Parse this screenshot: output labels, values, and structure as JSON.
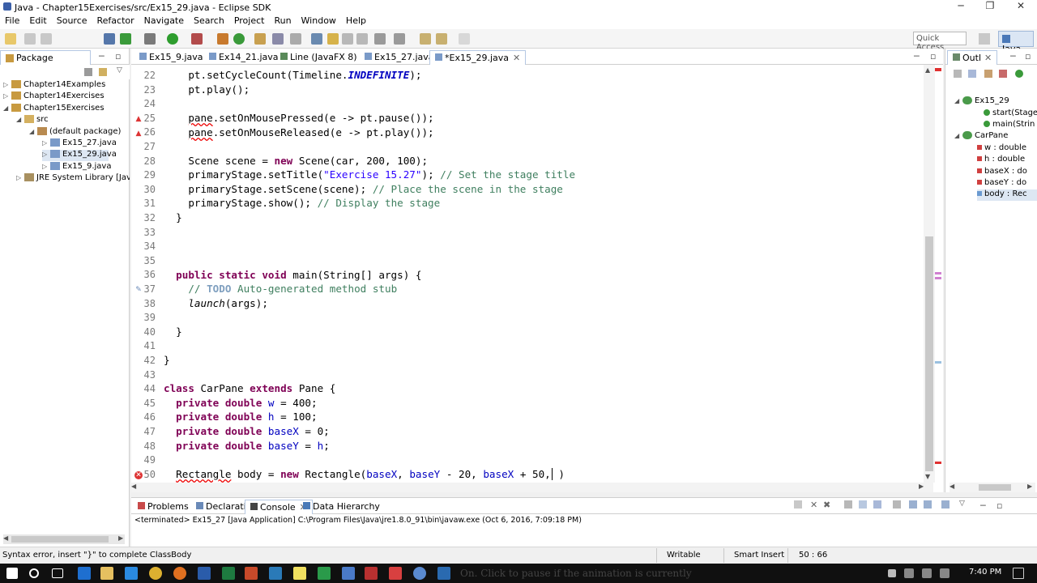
{
  "window": {
    "title": "Java - Chapter15Exercises/src/Ex15_29.java - Eclipse SDK",
    "minimize": "─",
    "maximize": "❐",
    "close": "✕"
  },
  "menu": [
    "File",
    "Edit",
    "Source",
    "Refactor",
    "Navigate",
    "Search",
    "Project",
    "Run",
    "Window",
    "Help"
  ],
  "toolbar": {
    "quick_access_placeholder": "Quick Access",
    "perspective_label": "Java"
  },
  "package_explorer": {
    "title": "Package Explorer",
    "items": [
      {
        "label": "Chapter14Examples"
      },
      {
        "label": "Chapter14Exercises"
      },
      {
        "label": "Chapter15Exercises"
      },
      {
        "label": "src"
      },
      {
        "label": "(default package)"
      },
      {
        "label": "Ex15_27.java"
      },
      {
        "label": "Ex15_29.java"
      },
      {
        "label": "Ex15_9.java"
      },
      {
        "label": "JRE System Library [JavaS"
      }
    ]
  },
  "editor": {
    "tabs": [
      {
        "label": "Ex15_9.java"
      },
      {
        "label": "Ex14_21.java"
      },
      {
        "label": "Line (JavaFX 8)"
      },
      {
        "label": "Ex15_27.java"
      },
      {
        "label": "*Ex15_29.java"
      }
    ],
    "line_numbers": [
      "22",
      "23",
      "24",
      "25",
      "26",
      "27",
      "28",
      "29",
      "30",
      "31",
      "32",
      "33",
      "34",
      "35",
      "36",
      "37",
      "38",
      "39",
      "40",
      "41",
      "42",
      "43",
      "44",
      "45",
      "46",
      "47",
      "48",
      "49",
      "50"
    ],
    "code": {
      "l22a": "pt.setCycleCount(Timeline.",
      "l22b": "INDEFINITE",
      "l22c": ");",
      "l23": "pt.play();",
      "l25a": "pane",
      "l25b": ".setOnMousePressed(e -> pt.pause());",
      "l26a": "pane",
      "l26b": ".setOnMouseReleased(e -> pt.play());",
      "l28a": "Scene scene = ",
      "l28kw": "new",
      "l28b": " Scene(car, 200, 100);",
      "l29a": "primaryStage.setTitle(",
      "l29s": "\"Exercise 15.27\"",
      "l29b": "); ",
      "l29c": "// Set the stage title",
      "l30a": "primaryStage.setScene(scene); ",
      "l30c": "// Place the scene in the stage",
      "l31a": "primaryStage.show(); ",
      "l31c": "// Display the stage",
      "l32": "}",
      "l36kw": "public static void",
      "l36b": " main(String[] args) {",
      "l37a": "// ",
      "l37t": "TODO",
      "l37b": " Auto-generated method stub",
      "l38a": "launch",
      "l38b": "(args);",
      "l40": "}",
      "l42": "}",
      "l44kw": "class",
      "l44a": " CarPane ",
      "l44kw2": "extends",
      "l44b": " Pane {",
      "l45kw": "private double",
      "l45f": "w",
      "l45b": " = 400;",
      "l46kw": "private double",
      "l46f": "h",
      "l46b": " = 100;",
      "l47kw": "private double",
      "l47f": "baseX",
      "l47b": " = 0;",
      "l48kw": "private double",
      "l48f": "baseY",
      "l48b": " = ",
      "l48f2": "h",
      "l48c": ";",
      "l50a": "Rectangle",
      "l50b": " body = ",
      "l50kw": "new",
      "l50c": " Rectangle(",
      "l50f": "baseX",
      "l50d": ", ",
      "l50f2": "baseY",
      "l50e": " - 20, ",
      "l50f3": "baseX",
      "l50g": " + 50,",
      "l50h": " )"
    }
  },
  "outline": {
    "title": "Outl",
    "items": [
      {
        "label": "Ex15_29"
      },
      {
        "label": "start(Stage"
      },
      {
        "label": "main(Strin"
      },
      {
        "label": "CarPane"
      },
      {
        "label": "w : double"
      },
      {
        "label": "h : double"
      },
      {
        "label": "baseX : do"
      },
      {
        "label": "baseY : do"
      },
      {
        "label": "body : Rec"
      }
    ]
  },
  "bottom_panel": {
    "tabs": [
      {
        "label": "Problems"
      },
      {
        "label": "Declaration"
      },
      {
        "label": "Console"
      },
      {
        "label": "Data Hierarchy"
      }
    ],
    "console_text": "<terminated> Ex15_27 [Java Application] C:\\Program Files\\Java\\jre1.8.0_91\\bin\\javaw.exe (Oct 6, 2016, 7:09:18 PM)"
  },
  "status": {
    "message": "Syntax error, insert \"}\" to complete ClassBody",
    "writable": "Writable",
    "insert_mode": "Smart Insert",
    "position": "50 : 66"
  },
  "taskbar": {
    "time": "7:40 PM",
    "overlay_text": "On. Click to pause if the animation is currently"
  },
  "colors": {
    "keyword": "#7f0055",
    "string": "#2a00ff",
    "comment": "#3f7f5f",
    "field": "#0000c0",
    "selection": "#dde7f3",
    "error": "#e00000"
  }
}
